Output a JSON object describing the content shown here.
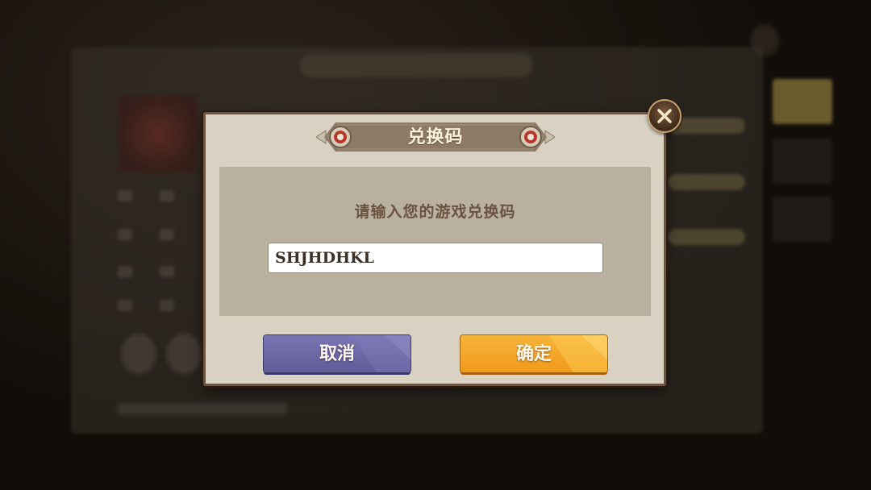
{
  "dialog": {
    "title": "兑换码",
    "prompt": "请输入您的游戏兑换码",
    "code_input": {
      "value": "SHJHDHKL",
      "placeholder": ""
    },
    "cancel_label": "取消",
    "confirm_label": "确定",
    "close_icon": "close-x-icon"
  },
  "colors": {
    "dialog_bg": "#d9d1c2",
    "content_bg": "#b9b0a0",
    "cancel_button": "#6d68a6",
    "confirm_button": "#f3a628",
    "ribbon": "#8c7a66"
  }
}
